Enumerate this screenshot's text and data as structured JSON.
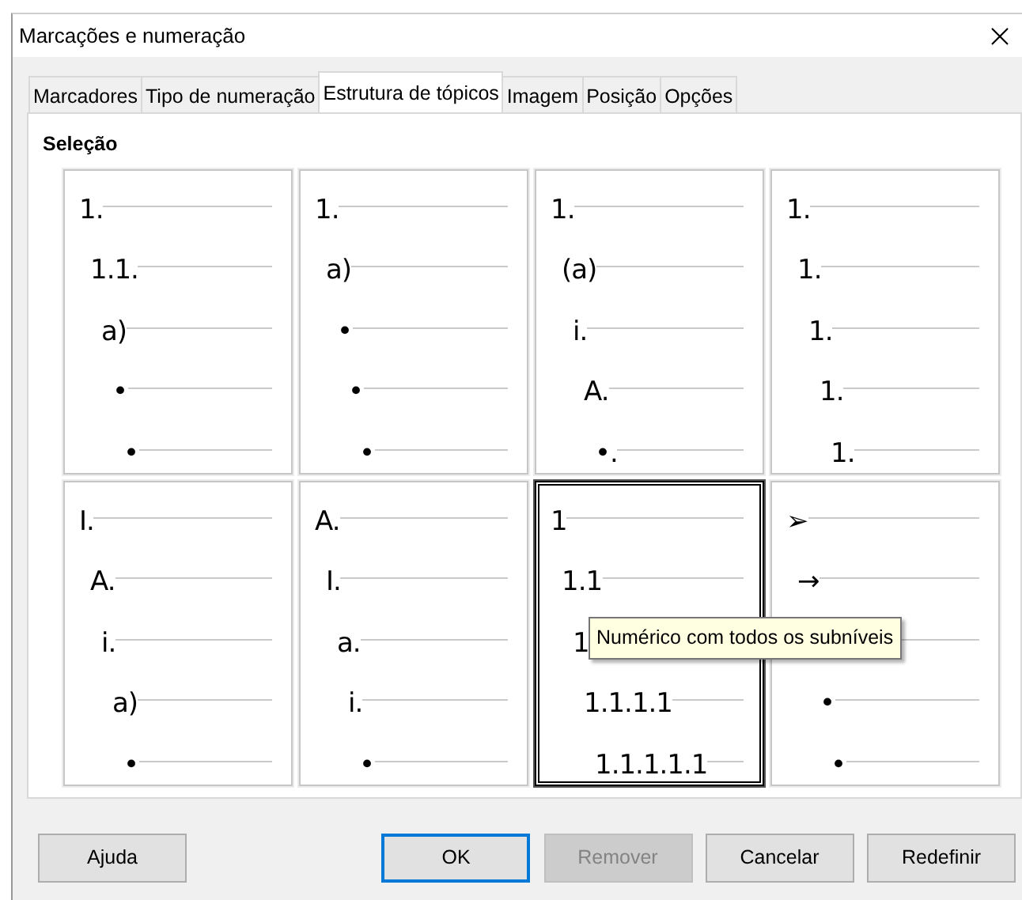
{
  "window": {
    "title": "Marcações e numeração"
  },
  "tabs": [
    {
      "label": "Marcadores",
      "selected": false
    },
    {
      "label": "Tipo de numeração",
      "selected": false
    },
    {
      "label": "Estrutura de tópicos",
      "selected": true
    },
    {
      "label": "Imagem",
      "selected": false
    },
    {
      "label": "Posição",
      "selected": false
    },
    {
      "label": "Opções",
      "selected": false
    }
  ],
  "section_title": "Seleção",
  "styles": [
    {
      "selected": false,
      "rows": [
        {
          "marker": "1."
        },
        {
          "marker": "1.1."
        },
        {
          "marker": "a)"
        },
        {
          "marker": "•"
        },
        {
          "marker": "•"
        }
      ]
    },
    {
      "selected": false,
      "rows": [
        {
          "marker": "1."
        },
        {
          "marker": "a)"
        },
        {
          "marker": "•"
        },
        {
          "marker": "•"
        },
        {
          "marker": "•"
        }
      ]
    },
    {
      "selected": false,
      "rows": [
        {
          "marker": "1."
        },
        {
          "marker": "(a)"
        },
        {
          "marker": "i."
        },
        {
          "marker": "A."
        },
        {
          "marker": "•."
        }
      ]
    },
    {
      "selected": false,
      "rows": [
        {
          "marker": "1."
        },
        {
          "marker": "1."
        },
        {
          "marker": "1."
        },
        {
          "marker": "1."
        },
        {
          "marker": "1."
        }
      ]
    },
    {
      "selected": false,
      "rows": [
        {
          "marker": "I."
        },
        {
          "marker": "A."
        },
        {
          "marker": "i."
        },
        {
          "marker": "a)"
        },
        {
          "marker": "•"
        }
      ]
    },
    {
      "selected": false,
      "rows": [
        {
          "marker": "A."
        },
        {
          "marker": "I."
        },
        {
          "marker": "a."
        },
        {
          "marker": "i."
        },
        {
          "marker": "•"
        }
      ]
    },
    {
      "selected": true,
      "rows": [
        {
          "marker": "1"
        },
        {
          "marker": "1.1"
        },
        {
          "marker": "1"
        },
        {
          "marker": "1.1.1.1"
        },
        {
          "marker": "1.1.1.1.1"
        }
      ]
    },
    {
      "selected": false,
      "rows": [
        {
          "marker": "➢"
        },
        {
          "marker": "→"
        },
        {},
        {
          "marker": "•"
        },
        {
          "marker": "•"
        }
      ]
    }
  ],
  "tooltip": "Numérico com todos os subníveis",
  "buttons": [
    {
      "label": "Ajuda",
      "disabled": false,
      "default": false
    },
    {
      "label": "OK",
      "disabled": false,
      "default": true
    },
    {
      "label": "Remover",
      "disabled": true,
      "default": false
    },
    {
      "label": "Cancelar",
      "disabled": false,
      "default": false
    },
    {
      "label": "Redefinir",
      "disabled": false,
      "default": false
    }
  ]
}
